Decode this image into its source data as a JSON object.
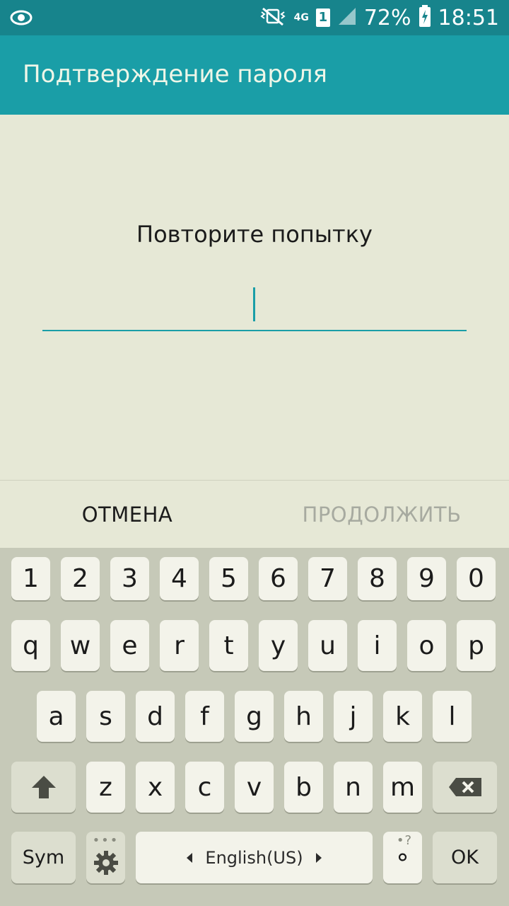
{
  "status_bar": {
    "network": "4G",
    "sim": "1",
    "battery": "72%",
    "time": "18:51",
    "icons": [
      "eye-icon",
      "vibrate-mute-icon",
      "signal-icon",
      "battery-charging-icon"
    ]
  },
  "app_bar": {
    "title": "Подтверждение пароля"
  },
  "content": {
    "prompt": "Повторите попытку",
    "password_value": ""
  },
  "actions": {
    "cancel_label": "ОТМЕНА",
    "continue_label": "ПРОДОЛЖИТЬ"
  },
  "keyboard": {
    "row_numbers": [
      "1",
      "2",
      "3",
      "4",
      "5",
      "6",
      "7",
      "8",
      "9",
      "0"
    ],
    "row_1": [
      "q",
      "w",
      "e",
      "r",
      "t",
      "y",
      "u",
      "i",
      "o",
      "p"
    ],
    "row_2": [
      "a",
      "s",
      "d",
      "f",
      "g",
      "h",
      "j",
      "k",
      "l"
    ],
    "row_3": [
      "z",
      "x",
      "c",
      "v",
      "b",
      "n",
      "m"
    ],
    "sym_label": "Sym",
    "settings_sub": "•••",
    "space_label": "English(US)",
    "punct_label": "°",
    "punct_sub": "•?",
    "ok_label": "OK"
  },
  "colors": {
    "status_bar": "#17848c",
    "app_bar": "#1a9ea7",
    "background": "#e6e8d6",
    "accent": "#1a9ea7",
    "keyboard_bg": "#c6c9b8"
  }
}
